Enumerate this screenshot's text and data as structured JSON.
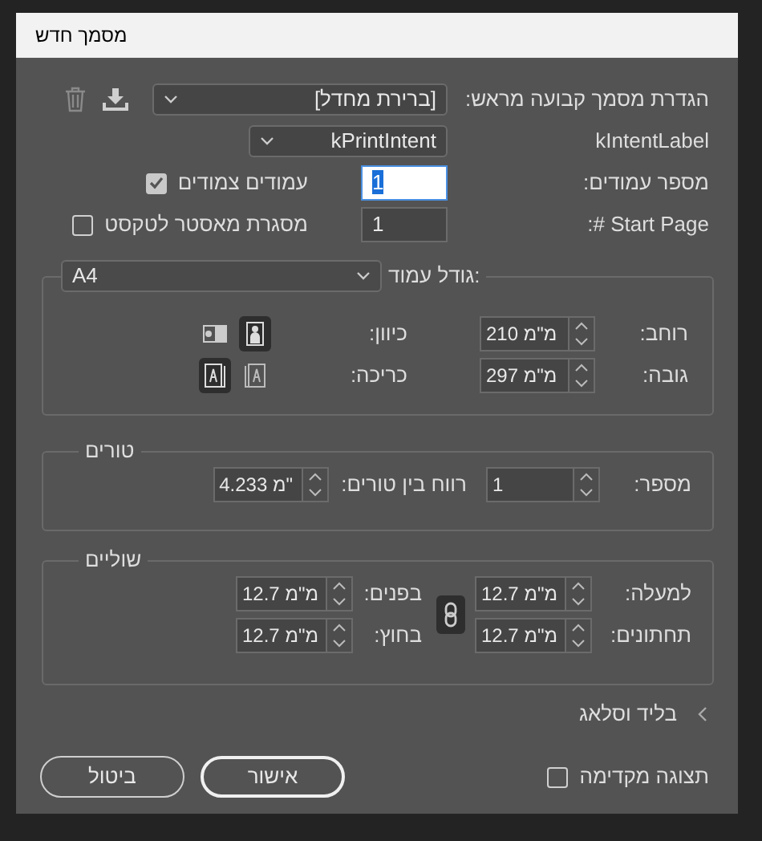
{
  "window": {
    "title": "מסמך חדש"
  },
  "preset": {
    "label": "הגדרת מסמך קבועה מראש:",
    "value": "[ברירת מחדל]"
  },
  "intent": {
    "label": "kIntentLabel",
    "value": "kPrintIntent"
  },
  "pages": {
    "label": "מספר עמודים:",
    "value": "1",
    "focused": true
  },
  "facing_pages": {
    "label": "עמודים צמודים",
    "checked": true
  },
  "start_page": {
    "label": "Start Page #:",
    "value": "1"
  },
  "master_text_frame": {
    "label": "מסגרת מאסטר לטקסט",
    "checked": false
  },
  "page_size": {
    "label": "גודל עמוד:",
    "value": "A4",
    "width": {
      "label": "רוחב:",
      "value": "210 מ\"מ"
    },
    "height": {
      "label": "גובה:",
      "value": "297 מ\"מ"
    },
    "orientation": {
      "label": "כיוון:",
      "options": [
        {
          "kind": "portrait",
          "selected": true
        },
        {
          "kind": "landscape",
          "selected": false
        }
      ]
    },
    "binding": {
      "label": "כריכה:",
      "options": [
        {
          "kind": "left",
          "selected": false
        },
        {
          "kind": "right",
          "selected": true
        }
      ]
    }
  },
  "columns": {
    "title": "טורים",
    "number": {
      "label": "מספר:",
      "value": "1"
    },
    "gutter": {
      "label": "רווח בין טורים:",
      "value": "4.233 מ\""
    }
  },
  "margins": {
    "title": "שוליים",
    "linked": true,
    "fields": [
      {
        "label": "למעלה:",
        "value": "12.7 מ\"מ"
      },
      {
        "label": "בפנים:",
        "value": "12.7 מ\"מ"
      },
      {
        "label": "תחתונים:",
        "value": "12.7 מ\"מ"
      },
      {
        "label": "בחוץ:",
        "value": "12.7 מ\"מ"
      }
    ]
  },
  "bleed": {
    "label": "בליד וסלאג",
    "expanded": false
  },
  "preview": {
    "label": "תצוגה מקדימה",
    "checked": false
  },
  "buttons": [
    {
      "label": "אישור",
      "default": true
    },
    {
      "label": "ביטול",
      "default": false
    }
  ]
}
